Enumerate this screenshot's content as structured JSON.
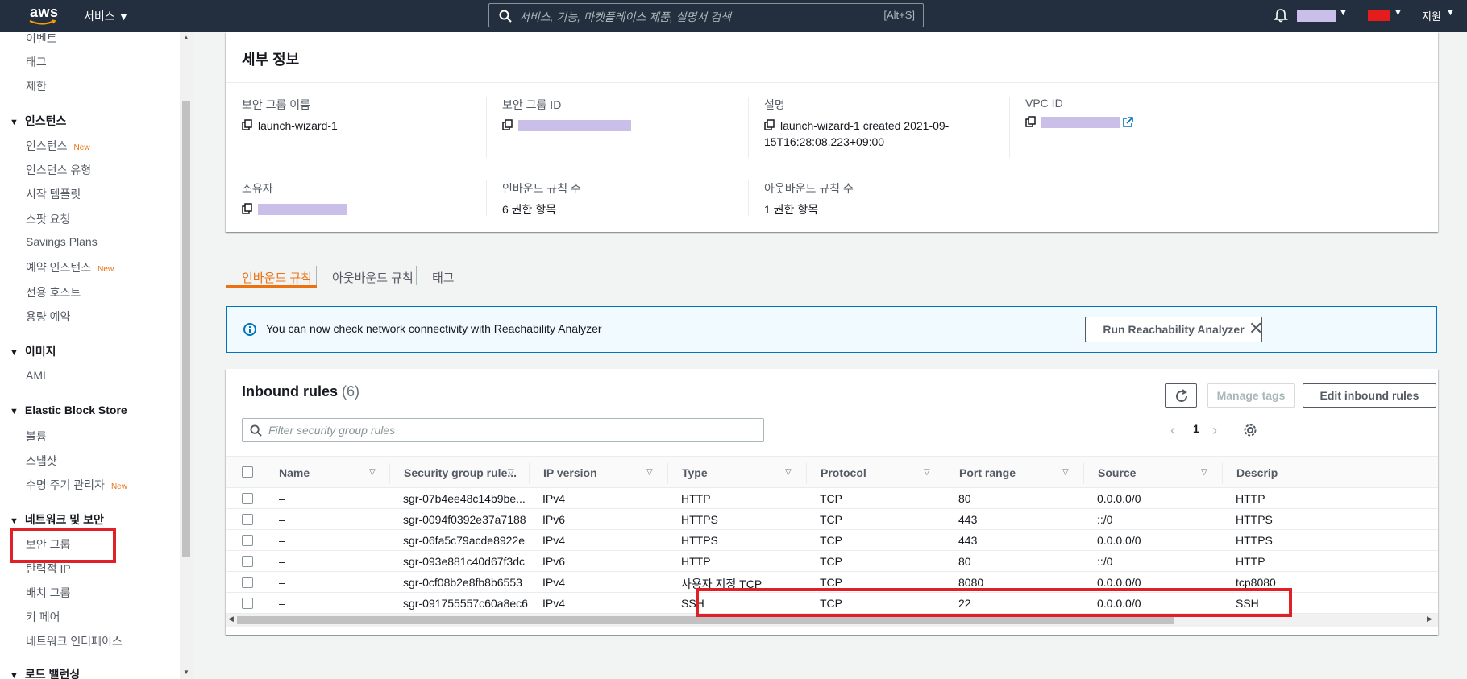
{
  "topbar": {
    "logo": "aws",
    "services_label": "서비스",
    "search_placeholder": "서비스, 기능, 마켓플레이스 제품, 설명서 검색",
    "search_shortcut": "[Alt+S]",
    "support_label": "지원"
  },
  "sidebar": {
    "items_top": [
      {
        "label": "이벤트"
      },
      {
        "label": "태그"
      },
      {
        "label": "제한"
      }
    ],
    "section_instances": "인스턴스",
    "instances_items": [
      {
        "label": "인스턴스",
        "new": "New"
      },
      {
        "label": "인스턴스 유형"
      },
      {
        "label": "시작 템플릿"
      },
      {
        "label": "스팟 요청"
      },
      {
        "label": "Savings Plans"
      },
      {
        "label": "예약 인스턴스",
        "new": "New"
      },
      {
        "label": "전용 호스트"
      },
      {
        "label": "용량 예약"
      }
    ],
    "section_images": "이미지",
    "images_items": [
      {
        "label": "AMI"
      }
    ],
    "section_ebs": "Elastic Block Store",
    "ebs_items": [
      {
        "label": "볼륨"
      },
      {
        "label": "스냅샷"
      },
      {
        "label": "수명 주기 관리자",
        "new": "New"
      }
    ],
    "section_network": "네트워크 및 보안",
    "network_items": [
      {
        "label": "보안 그룹"
      },
      {
        "label": "탄력적 IP"
      },
      {
        "label": "배치 그룹"
      },
      {
        "label": "키 페어"
      },
      {
        "label": "네트워크 인터페이스"
      }
    ],
    "section_lb": "로드 밸런싱"
  },
  "details": {
    "title": "세부 정보",
    "sg_name_label": "보안 그룹 이름",
    "sg_name_value": "launch-wizard-1",
    "sg_id_label": "보안 그룹 ID",
    "description_label": "설명",
    "description_value": "launch-wizard-1 created 2021-09-15T16:28:08.223+09:00",
    "vpc_label": "VPC ID",
    "owner_label": "소유자",
    "inbound_count_label": "인바운드 규칙 수",
    "inbound_count_value": "6 권한 항목",
    "outbound_count_label": "아웃바운드 규칙 수",
    "outbound_count_value": "1 권한 항목"
  },
  "tabs": [
    {
      "label": "인바운드 규칙"
    },
    {
      "label": "아웃바운드 규칙"
    },
    {
      "label": "태그"
    }
  ],
  "alert": {
    "message": "You can now check network connectivity with Reachability Analyzer",
    "button": "Run Reachability Analyzer"
  },
  "rules": {
    "title": "Inbound rules",
    "count": "(6)",
    "manage_tags": "Manage tags",
    "edit_button": "Edit inbound rules",
    "filter_placeholder": "Filter security group rules",
    "page": "1",
    "columns": [
      "Name",
      "Security group rule...",
      "IP version",
      "Type",
      "Protocol",
      "Port range",
      "Source",
      "Descrip"
    ],
    "rows": [
      {
        "name": "–",
        "rule": "sgr-07b4ee48c14b9be...",
        "ipv": "IPv4",
        "type": "HTTP",
        "protocol": "TCP",
        "port": "80",
        "source": "0.0.0.0/0",
        "desc": "HTTP"
      },
      {
        "name": "–",
        "rule": "sgr-0094f0392e37a7188",
        "ipv": "IPv6",
        "type": "HTTPS",
        "protocol": "TCP",
        "port": "443",
        "source": "::/0",
        "desc": "HTTPS"
      },
      {
        "name": "–",
        "rule": "sgr-06fa5c79acde8922e",
        "ipv": "IPv4",
        "type": "HTTPS",
        "protocol": "TCP",
        "port": "443",
        "source": "0.0.0.0/0",
        "desc": "HTTPS"
      },
      {
        "name": "–",
        "rule": "sgr-093e881c40d67f3dc",
        "ipv": "IPv6",
        "type": "HTTP",
        "protocol": "TCP",
        "port": "80",
        "source": "::/0",
        "desc": "HTTP"
      },
      {
        "name": "–",
        "rule": "sgr-0cf08b2e8fb8b6553",
        "ipv": "IPv4",
        "type": "사용자 지정 TCP",
        "protocol": "TCP",
        "port": "8080",
        "source": "0.0.0.0/0",
        "desc": "tcp8080"
      },
      {
        "name": "–",
        "rule": "sgr-091755557c60a8ec6",
        "ipv": "IPv4",
        "type": "SSH",
        "protocol": "TCP",
        "port": "22",
        "source": "0.0.0.0/0",
        "desc": "SSH"
      }
    ]
  },
  "colors": {
    "topbar_bg": "#232f3e",
    "accent_orange": "#ec7211",
    "highlight_red": "#e02027",
    "redaction": "#c9bfe8",
    "info_blue": "#0073bb"
  }
}
